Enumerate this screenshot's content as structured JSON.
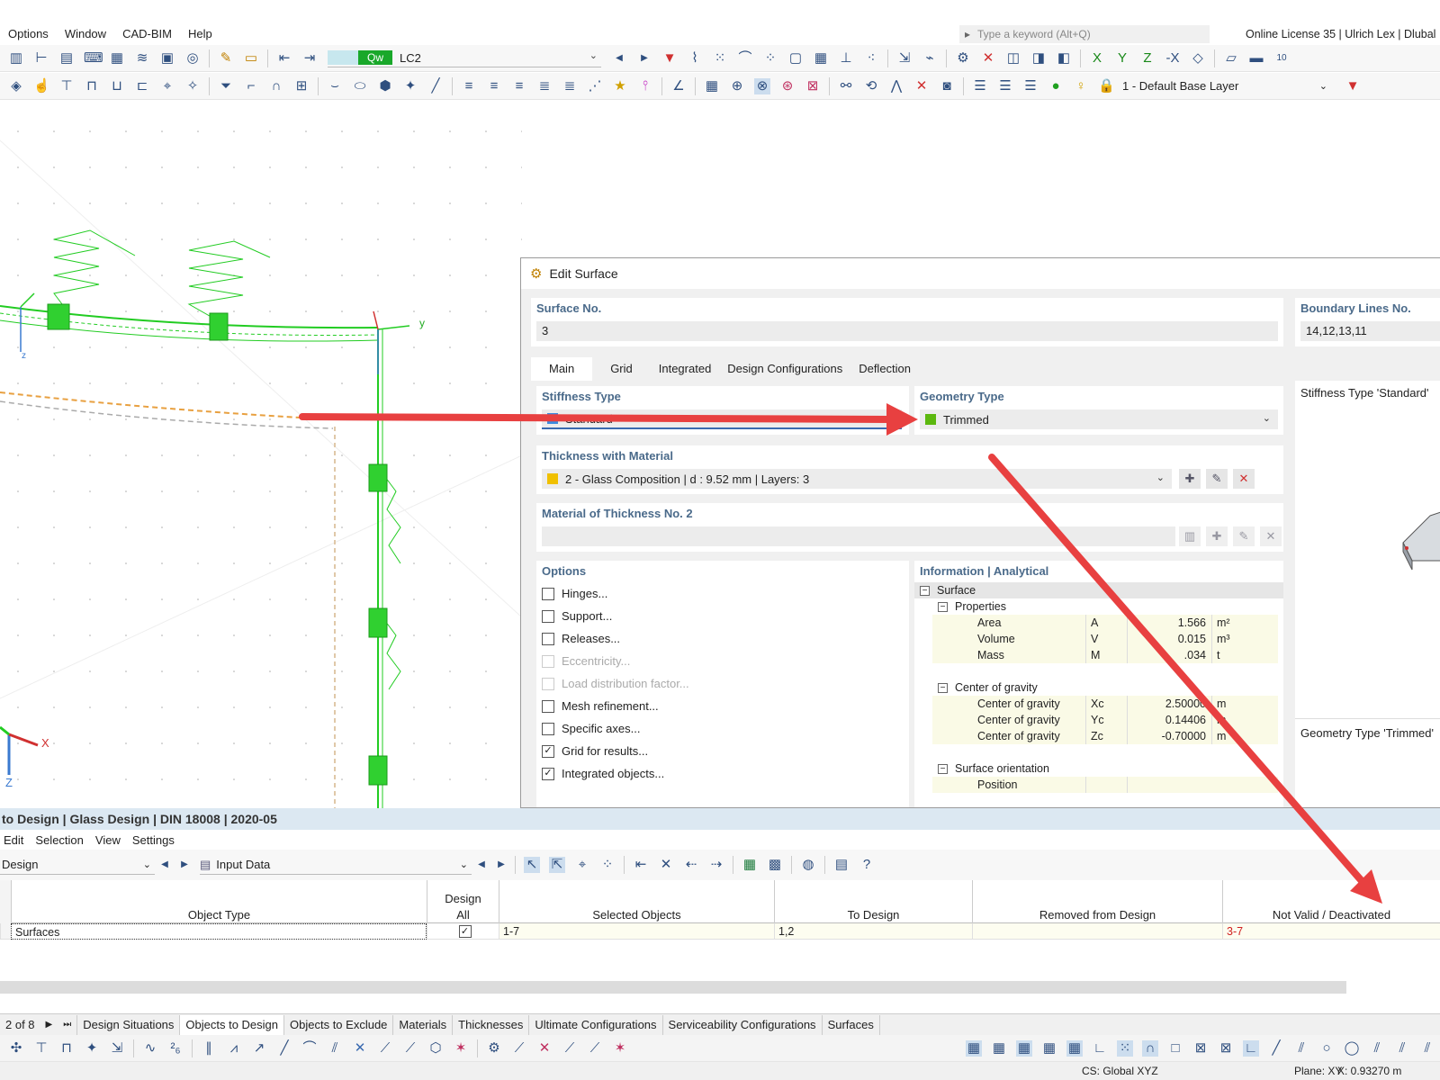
{
  "menubar": {
    "items": [
      "Options",
      "Window",
      "CAD-BIM",
      "Help"
    ],
    "search_placeholder": "Type a keyword (Alt+Q)",
    "license": "Online License 35 | Ulrich Lex | Dlubal"
  },
  "toolbar": {
    "load_case_badge": "Qw",
    "load_case": "LC2",
    "layer": "1 - Default Base Layer"
  },
  "viewport": {
    "axis_y": "y",
    "axis_z": "z",
    "axis_x_big": "X",
    "axis_z_big": "Z",
    "accent_green": "#22cc22"
  },
  "dialog": {
    "title": "Edit Surface",
    "surface_no_label": "Surface No.",
    "surface_no": "3",
    "boundary_label": "Boundary Lines No.",
    "boundary_value": "14,12,13,11",
    "tabs": [
      "Main",
      "Grid",
      "Integrated",
      "Design Configurations",
      "Deflection"
    ],
    "stiffness_label": "Stiffness Type",
    "stiffness_value": "Standard",
    "stiffness_color": "#3b8be0",
    "geometry_label": "Geometry Type",
    "geometry_value": "Trimmed",
    "geometry_color": "#5cb80f",
    "thickness_label": "Thickness with Material",
    "thickness_value": "2 - Glass Composition | d : 9.52 mm | Layers: 3",
    "thickness_color": "#f0c000",
    "material2_label": "Material of Thickness No. 2",
    "options_label": "Options",
    "options": [
      {
        "label": "Hinges...",
        "checked": false,
        "disabled": false
      },
      {
        "label": "Support...",
        "checked": false,
        "disabled": false
      },
      {
        "label": "Releases...",
        "checked": false,
        "disabled": false
      },
      {
        "label": "Eccentricity...",
        "checked": false,
        "disabled": true
      },
      {
        "label": "Load distribution factor...",
        "checked": false,
        "disabled": true
      },
      {
        "label": "Mesh refinement...",
        "checked": false,
        "disabled": false
      },
      {
        "label": "Specific axes...",
        "checked": false,
        "disabled": false
      },
      {
        "label": "Grid for results...",
        "checked": true,
        "disabled": false
      },
      {
        "label": "Integrated objects...",
        "checked": true,
        "disabled": false
      }
    ],
    "info_label": "Information | Analytical",
    "info": {
      "surface": "Surface",
      "properties": "Properties",
      "area": {
        "name": "Area",
        "sym": "A",
        "value": "1.566",
        "unit": "m²"
      },
      "volume": {
        "name": "Volume",
        "sym": "V",
        "value": "0.015",
        "unit": "m³"
      },
      "mass": {
        "name": "Mass",
        "sym": "M",
        "value": ".034",
        "unit": "t"
      },
      "cog": "Center of gravity",
      "xc": {
        "name": "Center of gravity",
        "sym": "Xc",
        "value": "2.50000",
        "unit": "m"
      },
      "yc": {
        "name": "Center of gravity",
        "sym": "Yc",
        "value": "0.14406",
        "unit": "m"
      },
      "zc": {
        "name": "Center of gravity",
        "sym": "Zc",
        "value": "-0.70000",
        "unit": "m"
      },
      "orientation": "Surface orientation",
      "position": "Position"
    },
    "side_stiffness": "Stiffness Type 'Standard'",
    "side_geometry": "Geometry Type 'Trimmed'"
  },
  "panel": {
    "title": "to Design | Glass Design | DIN 18008 | 2020-05",
    "menu": [
      "Edit",
      "Selection",
      "View",
      "Settings"
    ],
    "combo1": "Design",
    "combo2": "Input Data"
  },
  "table": {
    "headers": {
      "object_type": "Object Type",
      "design_all_1": "Design",
      "design_all_2": "All",
      "selected": "Selected Objects",
      "to_design": "To Design",
      "removed": "Removed from Design",
      "not_valid": "Not Valid / Deactivated"
    },
    "row": {
      "object_type": "Surfaces",
      "selected": "1-7",
      "to_design": "1,2",
      "removed": "",
      "not_valid": "3-7"
    }
  },
  "sheet_tabs": {
    "page": "2 of 8",
    "tabs": [
      "Design Situations",
      "Objects to Design",
      "Objects to Exclude",
      "Materials",
      "Thicknesses",
      "Ultimate Configurations",
      "Serviceability Configurations",
      "Surfaces"
    ],
    "active": "Objects to Design"
  },
  "status": {
    "cs": "CS: Global XYZ",
    "plane": "Plane: XY",
    "coord": "X: 0.93270 m"
  },
  "colors": {
    "arrow_red": "#e84040",
    "not_valid_red": "#d02020"
  }
}
